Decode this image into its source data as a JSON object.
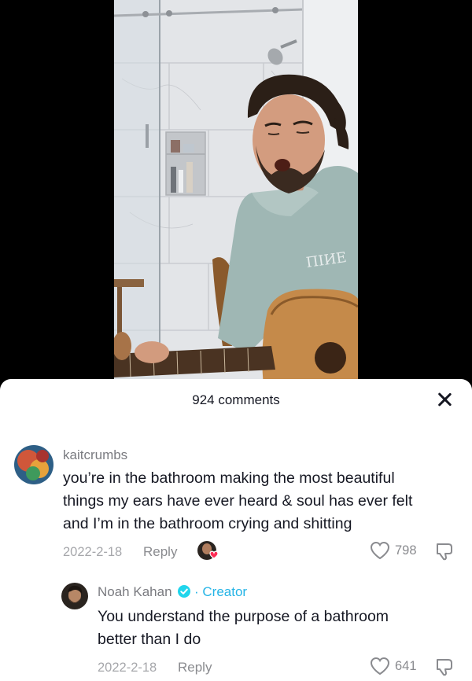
{
  "comments_panel": {
    "count_label": "924 comments"
  },
  "comments": [
    {
      "username": "kaitcrumbs",
      "text_lines": [
        "you’re in the bathroom making the most beautiful",
        "things my ears have ever heard & soul has ever felt",
        "and I’m in the bathroom crying and shitting"
      ],
      "date": "2022-2-18",
      "reply_label": "Reply",
      "likes": "798",
      "liked_by_creator": true
    },
    {
      "username": "Noah Kahan",
      "verified": true,
      "creator_label": "· Creator",
      "text_lines": [
        "You understand the purpose of a bathroom",
        "better than I do"
      ],
      "date": "2022-2-18",
      "reply_label": "Reply",
      "likes": "641"
    }
  ],
  "colors": {
    "sheet_bg": "#ffffff",
    "primary_text": "#161823",
    "secondary_text": "#8a8b8f",
    "creator_accent": "#25b4e6",
    "liked_heart": "#fe2c55"
  },
  "icons": [
    "close-icon",
    "heart-outline-icon",
    "dislike-icon",
    "verified-check-icon",
    "creator-liked-badge-icon"
  ]
}
